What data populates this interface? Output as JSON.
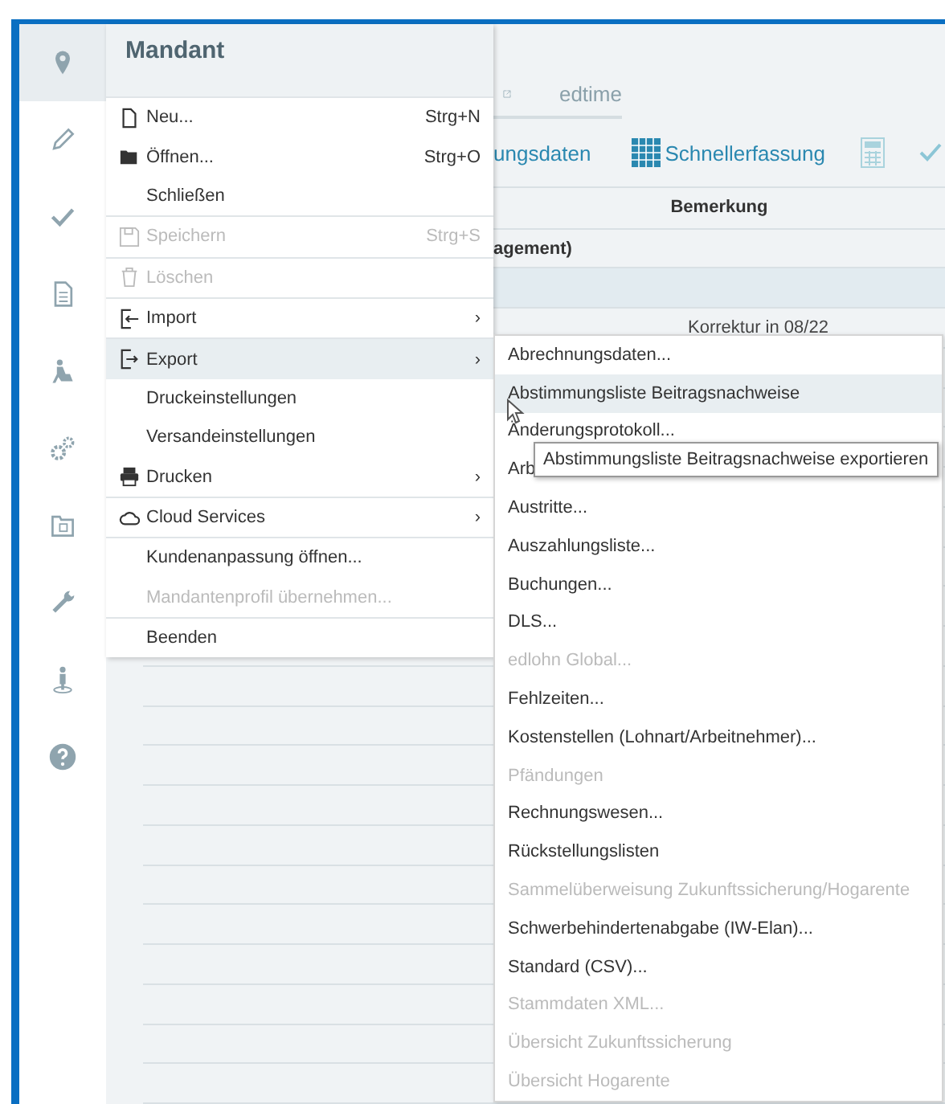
{
  "sidebar": {
    "items": [
      {
        "kind": "pin",
        "selected": true
      },
      {
        "kind": "pencil",
        "selected": false
      },
      {
        "kind": "check",
        "selected": false
      },
      {
        "kind": "document",
        "selected": false
      },
      {
        "kind": "worker",
        "selected": false
      },
      {
        "kind": "gears",
        "selected": false
      },
      {
        "kind": "folder",
        "selected": false
      },
      {
        "kind": "wrench",
        "selected": false
      },
      {
        "kind": "person",
        "selected": false
      },
      {
        "kind": "help",
        "selected": false
      }
    ]
  },
  "tab": {
    "label": "edtime"
  },
  "toolbar": {
    "items": [
      {
        "kind": "link",
        "label": "ungsdaten"
      },
      {
        "kind": "grid",
        "label": "Schnellerfassung"
      },
      {
        "kind": "calculator"
      },
      {
        "kind": "check"
      }
    ]
  },
  "table": {
    "columns": [
      "Bemerkung"
    ],
    "group_row": "agement)",
    "rows": [
      {
        "selected": true
      },
      {
        "selected": false,
        "bemerkung": "Korrektur in 08/22"
      },
      {
        "selected": false
      },
      {
        "selected": false
      },
      {
        "selected": false
      },
      {
        "selected": false
      },
      {
        "selected": false
      },
      {
        "selected": false
      },
      {
        "selected": false
      },
      {
        "selected": false
      },
      {
        "selected": false
      },
      {
        "selected": false
      },
      {
        "selected": false
      },
      {
        "selected": false
      },
      {
        "selected": false
      },
      {
        "selected": false
      },
      {
        "selected": false
      },
      {
        "selected": false
      },
      {
        "selected": false
      },
      {
        "selected": false
      },
      {
        "selected": false
      }
    ]
  },
  "menu": {
    "title": "Mandant",
    "groups": [
      [
        {
          "label": "Neu...",
          "kind": "file",
          "shortcut": "Strg+N",
          "disabled": false,
          "selected": false
        },
        {
          "label": "Öffnen...",
          "kind": "folder",
          "shortcut": "Strg+O",
          "disabled": false,
          "selected": false
        },
        {
          "label": "Schließen",
          "disabled": false,
          "selected": false
        }
      ],
      [
        {
          "label": "Speichern",
          "kind": "save",
          "shortcut": "Strg+S",
          "disabled": true,
          "selected": false
        }
      ],
      [
        {
          "label": "Löschen",
          "kind": "trash",
          "disabled": true,
          "selected": false
        }
      ],
      [
        {
          "label": "Import",
          "kind": "import",
          "arrow": "›",
          "disabled": false,
          "selected": false
        }
      ],
      [
        {
          "label": "Export",
          "kind": "export",
          "arrow": "›",
          "disabled": false,
          "selected": true
        },
        {
          "label": "Druckeinstellungen",
          "disabled": false,
          "selected": false
        },
        {
          "label": "Versandeinstellungen",
          "disabled": false,
          "selected": false
        },
        {
          "label": "Drucken",
          "kind": "printer",
          "arrow": "›",
          "disabled": false,
          "selected": false
        }
      ],
      [
        {
          "label": "Cloud Services",
          "kind": "cloud",
          "arrow": "›",
          "disabled": false,
          "selected": false
        }
      ],
      [
        {
          "label": "Kundenanpassung öffnen...",
          "disabled": false,
          "selected": false
        },
        {
          "label": "Mandantenprofil übernehmen...",
          "disabled": true,
          "selected": false
        }
      ],
      [
        {
          "label": "Beenden",
          "disabled": false,
          "selected": false
        }
      ]
    ]
  },
  "submenu": {
    "items": [
      {
        "label": "Abrechnungsdaten...",
        "disabled": false,
        "selected": false
      },
      {
        "label": "Abstimmungsliste Beitragsnachweise",
        "disabled": false,
        "selected": true
      },
      {
        "label": "Änderungsprotokoll...",
        "disabled": false,
        "selected": false
      },
      {
        "label": "Arb",
        "disabled": false,
        "selected": false
      },
      {
        "label": "Austritte...",
        "disabled": false,
        "selected": false
      },
      {
        "label": "Auszahlungsliste...",
        "disabled": false,
        "selected": false
      },
      {
        "label": "Buchungen...",
        "disabled": false,
        "selected": false
      },
      {
        "label": "DLS...",
        "disabled": false,
        "selected": false
      },
      {
        "label": "edlohn Global...",
        "disabled": true,
        "selected": false
      },
      {
        "label": "Fehlzeiten...",
        "disabled": false,
        "selected": false
      },
      {
        "label": "Kostenstellen (Lohnart/Arbeitnehmer)...",
        "disabled": false,
        "selected": false
      },
      {
        "label": "Pfändungen",
        "disabled": true,
        "selected": false
      },
      {
        "label": "Rechnungswesen...",
        "disabled": false,
        "selected": false
      },
      {
        "label": "Rückstellungslisten",
        "disabled": false,
        "selected": false
      },
      {
        "label": "Sammelüberweisung Zukunftssicherung/Hogarente",
        "disabled": true,
        "selected": false
      },
      {
        "label": "Schwerbehindertenabgabe (IW-Elan)...",
        "disabled": false,
        "selected": false
      },
      {
        "label": "Standard (CSV)...",
        "disabled": false,
        "selected": false
      },
      {
        "label": "Stammdaten XML...",
        "disabled": true,
        "selected": false
      },
      {
        "label": "Übersicht Zukunftssicherung",
        "disabled": true,
        "selected": false
      },
      {
        "label": "Übersicht Hogarente",
        "disabled": true,
        "selected": false
      }
    ]
  },
  "tooltip": {
    "text": "Abstimmungsliste Beitragsnachweise exportieren"
  }
}
